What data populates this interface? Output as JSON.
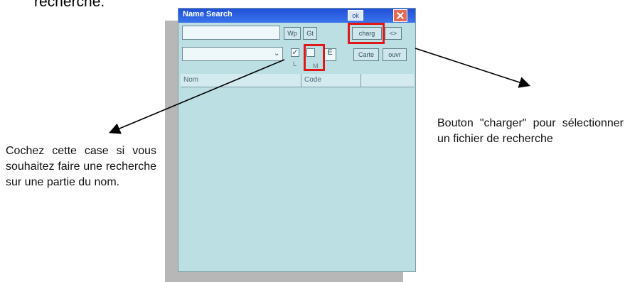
{
  "top_text": "recherche.",
  "device": {
    "title": "Name Search",
    "ok_label": "ok",
    "buttons": {
      "wp": "Wp",
      "gt": "Gt",
      "charger": "charg",
      "nav": "<>",
      "carte": "Carte",
      "ouvr": "ouvr"
    },
    "checkboxes": {
      "l_label": "L",
      "m_label": "M",
      "l_mark": "✓",
      "e_label": "E"
    },
    "columns": {
      "nom": "Nom",
      "code": "Code"
    }
  },
  "callouts": {
    "left": "Cochez cette case si vous souhaitez faire une recherche sur une partie du nom.",
    "right": "Bouton \"charger\" pour sélectionner un fichier de recherche"
  },
  "colors": {
    "highlight": "#e01818",
    "titlebar": "#1f4fd7",
    "screen": "#bcdfe4"
  }
}
